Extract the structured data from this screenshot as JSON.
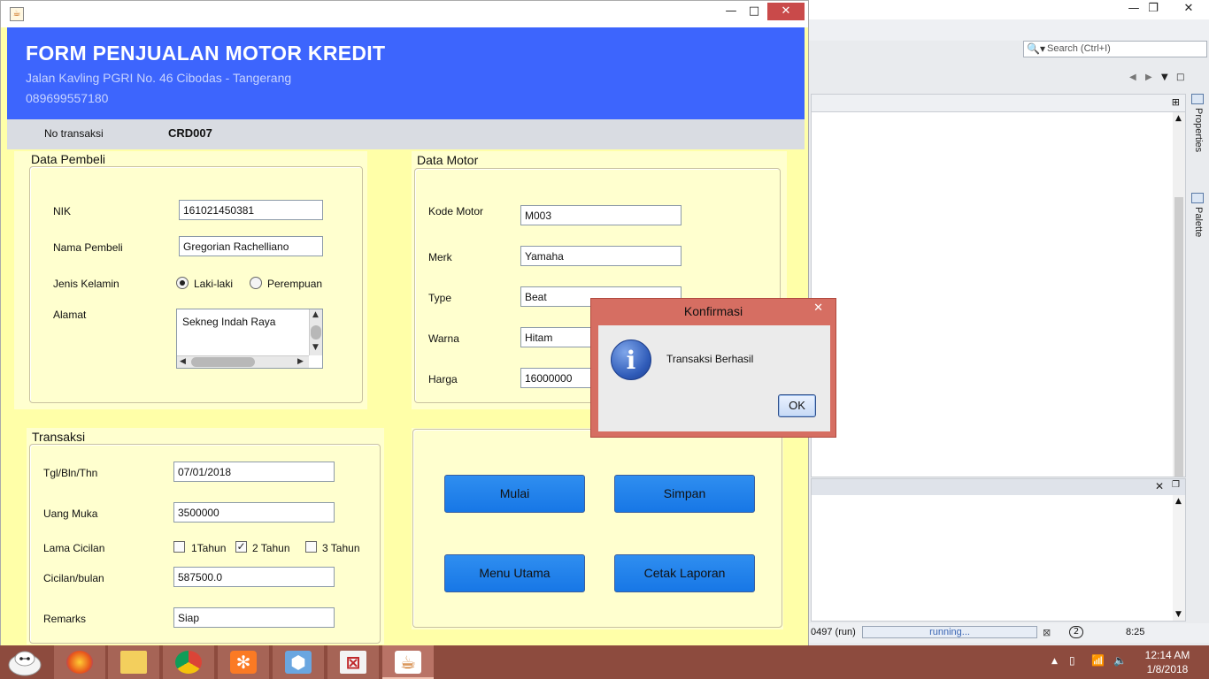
{
  "window": {
    "minimize": "—",
    "maximize": "□",
    "close": "✕"
  },
  "header": {
    "title": "FORM PENJUALAN MOTOR KREDIT",
    "address": "Jalan Kavling PGRI No. 46  Cibodas - Tangerang",
    "phone": "089699557180"
  },
  "transaction_no": {
    "label": "No transaksi",
    "value": "CRD007"
  },
  "data_pembeli": {
    "title": "Data Pembeli",
    "nik_label": "NIK",
    "nik_value": "161021450381",
    "nama_label": "Nama Pembeli",
    "nama_value": "Gregorian Rachelliano",
    "jenis_kelamin_label": "Jenis Kelamin",
    "option_laki": "Laki-laki",
    "option_perempuan": "Perempuan",
    "selected_gender": "Laki-laki",
    "alamat_label": "Alamat",
    "alamat_value": "Sekneg Indah Raya"
  },
  "data_motor": {
    "title": "Data Motor",
    "kode_label": "Kode Motor",
    "kode_value": "M003",
    "merk_label": "Merk",
    "merk_value": "Yamaha",
    "type_label": "Type",
    "type_value": "Beat",
    "warna_label": "Warna",
    "warna_value": "Hitam",
    "harga_label": "Harga",
    "harga_value": "16000000"
  },
  "transaksi": {
    "title": "Transaksi",
    "tgl_label": "Tgl/Bln/Thn",
    "tgl_value": "07/01/2018",
    "uang_muka_label": "Uang Muka",
    "uang_muka_value": "3500000",
    "lama_cicilan_label": "Lama Cicilan",
    "opt_1": "1Tahun",
    "opt_2": "2 Tahun",
    "opt_3": "3 Tahun",
    "opt_1_checked": false,
    "opt_2_checked": true,
    "opt_3_checked": false,
    "cicilan_label": "Cicilan/bulan",
    "cicilan_value": "587500.0",
    "remarks_label": "Remarks",
    "remarks_value": "Siap"
  },
  "buttons": {
    "mulai": "Mulai",
    "simpan": "Simpan",
    "menu_utama": "Menu Utama",
    "cetak_laporan": "Cetak Laporan"
  },
  "dialog": {
    "title": "Konfirmasi",
    "message": "Transaksi Berhasil",
    "ok": "OK",
    "close": "✕"
  },
  "ide": {
    "search_placeholder": "Search (Ctrl+I)",
    "side_properties": "Properties",
    "side_palette": "Palette",
    "process_label": "0497 (run)",
    "progress_text": "running...",
    "progress_badge": "2",
    "caret_position": "8:25"
  },
  "taskbar": {
    "time": "12:14 AM",
    "date": "1/8/2018"
  },
  "colors": {
    "header_bg": "#3d65fd",
    "form_bg": "#ffffa8",
    "panel_bg": "#ffffcf",
    "button_bg": "#1f80ea",
    "dialog_frame": "#d66e62",
    "taskbar_bg": "#8d4b3e"
  }
}
